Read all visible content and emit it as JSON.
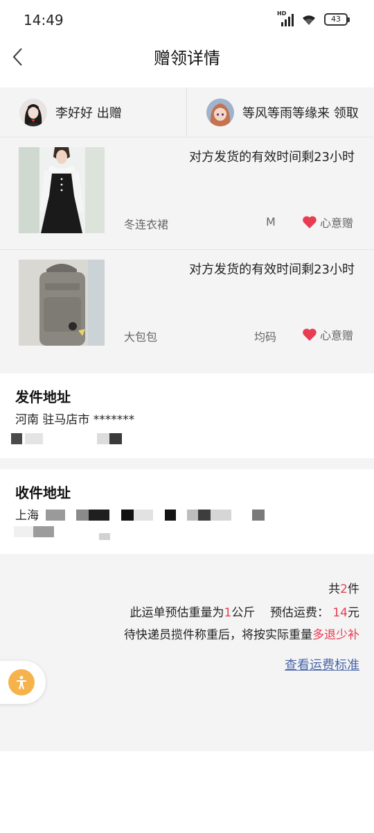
{
  "status_bar": {
    "time": "14:49",
    "network_label": "HD",
    "battery_level": "43"
  },
  "nav": {
    "title": "赠领详情",
    "back_icon": "chevron-left-icon"
  },
  "parties": {
    "giver": {
      "name": "李好好",
      "action": "出赠"
    },
    "receiver": {
      "name": "等风等雨等缘来",
      "action": "领取"
    }
  },
  "items": [
    {
      "deadline": "对方发货的有效时间剩23小时",
      "name": "冬连衣裙",
      "size": "M",
      "tag": "心意赠",
      "tag_icon": "heart-icon"
    },
    {
      "deadline": "对方发货的有效时间剩23小时",
      "name": "大包包",
      "size": "均码",
      "tag": "心意赠",
      "tag_icon": "heart-icon"
    }
  ],
  "send_address": {
    "title": "发件地址",
    "line1": "河南 驻马店市 *******"
  },
  "recv_address": {
    "title": "收件地址",
    "line1": "上海"
  },
  "summary": {
    "total_prefix": "共",
    "total_count": "2",
    "total_suffix": "件",
    "weight_prefix": "此运单预估重量为",
    "weight_value": "1",
    "weight_unit": "公斤",
    "fee_label": "预估运费：",
    "fee_value": "14",
    "fee_unit": "元",
    "note_prefix": "待快递员揽件称重后，将按实际重量",
    "note_highlight": "多退少补",
    "fee_standard_link": "查看运费标准"
  },
  "colors": {
    "accent_red": "#e83c53",
    "link_blue": "#4a67a8",
    "a11y_orange": "#f7b34b"
  },
  "floating_button_icon": "accessibility-icon"
}
